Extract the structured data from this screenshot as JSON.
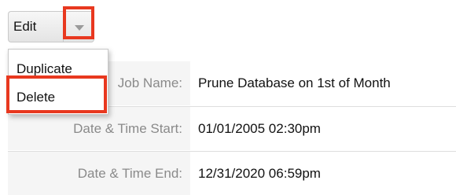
{
  "toolbar": {
    "edit_label": "Edit",
    "caret_icon": "caret-down-icon"
  },
  "menu": {
    "items": [
      {
        "label": "Duplicate"
      },
      {
        "label": "Delete"
      }
    ]
  },
  "details": {
    "rows": [
      {
        "label": "Job Name:",
        "value": "Prune Database on 1st of Month"
      },
      {
        "label": "Date & Time Start:",
        "value": "01/01/2005 02:30pm"
      },
      {
        "label": "Date & Time End:",
        "value": "12/31/2020 06:59pm"
      }
    ]
  },
  "colors": {
    "highlight": "#e8381f",
    "label_bg": "#f5f5f5",
    "label_text": "#8a8a8a"
  }
}
